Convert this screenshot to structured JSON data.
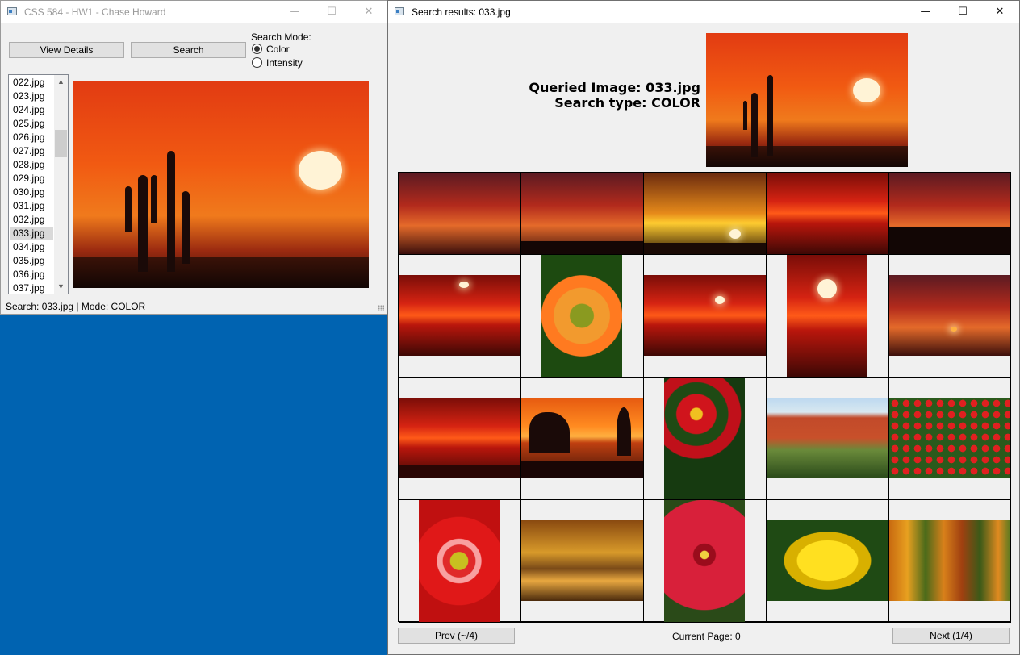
{
  "main_window": {
    "title": "CSS 584 - HW1 - Chase Howard",
    "buttons": {
      "view_details": "View Details",
      "search": "Search"
    },
    "search_mode": {
      "label": "Search Mode:",
      "options": [
        {
          "label": "Color",
          "selected": true
        },
        {
          "label": "Intensity",
          "selected": false
        }
      ]
    },
    "file_list": {
      "items": [
        "022.jpg",
        "023.jpg",
        "024.jpg",
        "025.jpg",
        "026.jpg",
        "027.jpg",
        "028.jpg",
        "029.jpg",
        "030.jpg",
        "031.jpg",
        "032.jpg",
        "033.jpg",
        "034.jpg",
        "035.jpg",
        "036.jpg",
        "037.jpg"
      ],
      "selected": "033.jpg"
    },
    "status": "Search: 033.jpg | Mode: COLOR"
  },
  "results_window": {
    "title": "Search results: 033.jpg",
    "query_label": "Queried Image: 033.jpg",
    "search_type_label": "Search type: COLOR",
    "prev_button": "Prev (~/4)",
    "next_button": "Next (1/4)",
    "current_page": "Current Page: 0"
  },
  "icons": {
    "minimize": "minimize-icon",
    "maximize": "maximize-icon",
    "close": "close-icon",
    "scroll_up": "chevron-up-icon",
    "scroll_down": "chevron-down-icon"
  },
  "colors": {
    "desktop": "#0063b1",
    "window_bg": "#f0f0f0"
  }
}
